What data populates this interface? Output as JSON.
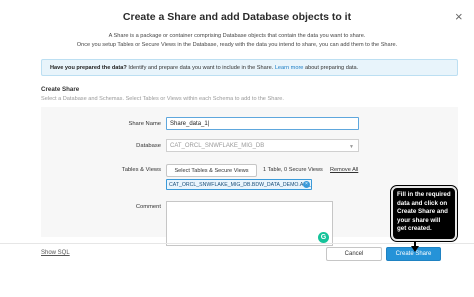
{
  "dialog": {
    "title": "Create a Share and add Database objects to it",
    "close_glyph": "×",
    "description_line1": "A Share is a package or container comprising Database objects that contain the data you want to share.",
    "description_line2": "Once you setup Tables or Secure Views in the Database, ready with the data you intend to share, you can add them to the Share."
  },
  "info_banner": {
    "question": "Have you prepared the data?",
    "text": " Identify and prepare data you want to include in the Share. ",
    "link": "Learn more",
    "suffix": " about preparing data."
  },
  "section": {
    "title": "Create Share",
    "subtitle": "Select a Database and Schemas. Select Tables or Views within each Schema to add to the Share."
  },
  "form": {
    "share_name_label": "Share Name",
    "share_name_value": "Share_data_1|",
    "database_label": "Database",
    "database_value": "CAT_ORCL_SNWFLAKE_MIG_DB",
    "tables_label": "Tables & Views",
    "select_button": "Select Tables & Secure Views",
    "counts_text": "1 Table, 0 Secure Views",
    "remove_all": "Remove All",
    "chip": "CAT_ORCL_SNWFLAKE_MIG_DB.BDW_DATA_DEMO.ALL_MEM",
    "comment_label": "Comment"
  },
  "footer": {
    "show_sql": "Show SQL",
    "cancel": "Cancel",
    "create_share": "Create Share"
  },
  "callout": {
    "text": "Fill in the required data and click on Create Share and your share will get created."
  },
  "colors": {
    "primary": "#2593d8",
    "info_bg": "#e8f4fb",
    "chip_border": "#3a9ad9",
    "grammarly": "#15c39a",
    "callout_bg": "#000000"
  }
}
